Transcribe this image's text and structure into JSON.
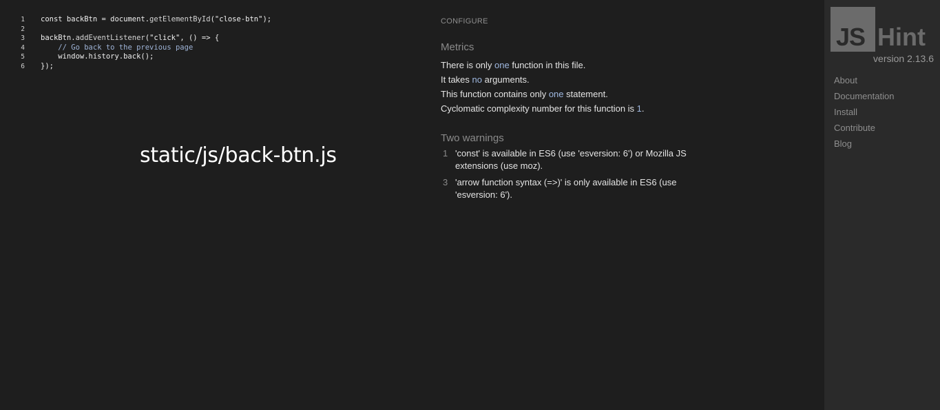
{
  "editor": {
    "lines": [
      {
        "n": "1",
        "tokens": [
          {
            "t": "const backBtn = document.",
            "c": "plain"
          },
          {
            "t": "getElementById",
            "c": "fn"
          },
          {
            "t": "(",
            "c": "plain"
          },
          {
            "t": "\"close-btn\"",
            "c": "str"
          },
          {
            "t": ");",
            "c": "plain"
          }
        ]
      },
      {
        "n": "2",
        "tokens": []
      },
      {
        "n": "3",
        "tokens": [
          {
            "t": "backBtn.",
            "c": "plain"
          },
          {
            "t": "addEventListener",
            "c": "fn"
          },
          {
            "t": "(",
            "c": "plain"
          },
          {
            "t": "\"click\"",
            "c": "str"
          },
          {
            "t": ", () => {",
            "c": "plain"
          }
        ]
      },
      {
        "n": "4",
        "tokens": [
          {
            "t": "    ",
            "c": "plain"
          },
          {
            "t": "// Go back to the previous page",
            "c": "comment"
          }
        ]
      },
      {
        "n": "5",
        "tokens": [
          {
            "t": "    window.history.back();",
            "c": "plain"
          }
        ]
      },
      {
        "n": "6",
        "tokens": [
          {
            "t": "});",
            "c": "plain"
          }
        ]
      }
    ],
    "filename": "static/js/back-btn.js"
  },
  "report": {
    "configure_label": "CONFIGURE",
    "metrics": {
      "title": "Metrics",
      "lines": [
        {
          "pre": "There is only ",
          "hl": "one",
          "post": " function in this file."
        },
        {
          "pre": "It takes ",
          "hl": "no",
          "post": " arguments."
        },
        {
          "pre": "This function contains only ",
          "hl": "one",
          "post": " statement."
        },
        {
          "pre": "Cyclomatic complexity number for this function is ",
          "hl": "1",
          "post": "."
        }
      ]
    },
    "warnings": {
      "title": "Two warnings",
      "items": [
        {
          "line": "1",
          "message": "'const' is available in ES6 (use 'esversion: 6') or Mozilla JS extensions (use moz)."
        },
        {
          "line": "3",
          "message": "'arrow function syntax (=>)' is only available in ES6 (use 'esversion: 6')."
        }
      ]
    }
  },
  "sidebar": {
    "logo_js": "JS",
    "logo_hint": "Hint",
    "version": "version 2.13.6",
    "nav": [
      {
        "label": "About"
      },
      {
        "label": "Documentation"
      },
      {
        "label": "Install"
      },
      {
        "label": "Contribute"
      },
      {
        "label": "Blog"
      }
    ]
  },
  "colors": {
    "background": "#1e1e1e",
    "sidebar": "#2a2a2a",
    "logo": "#6b6b6b",
    "highlight": "#9fb8e0"
  }
}
